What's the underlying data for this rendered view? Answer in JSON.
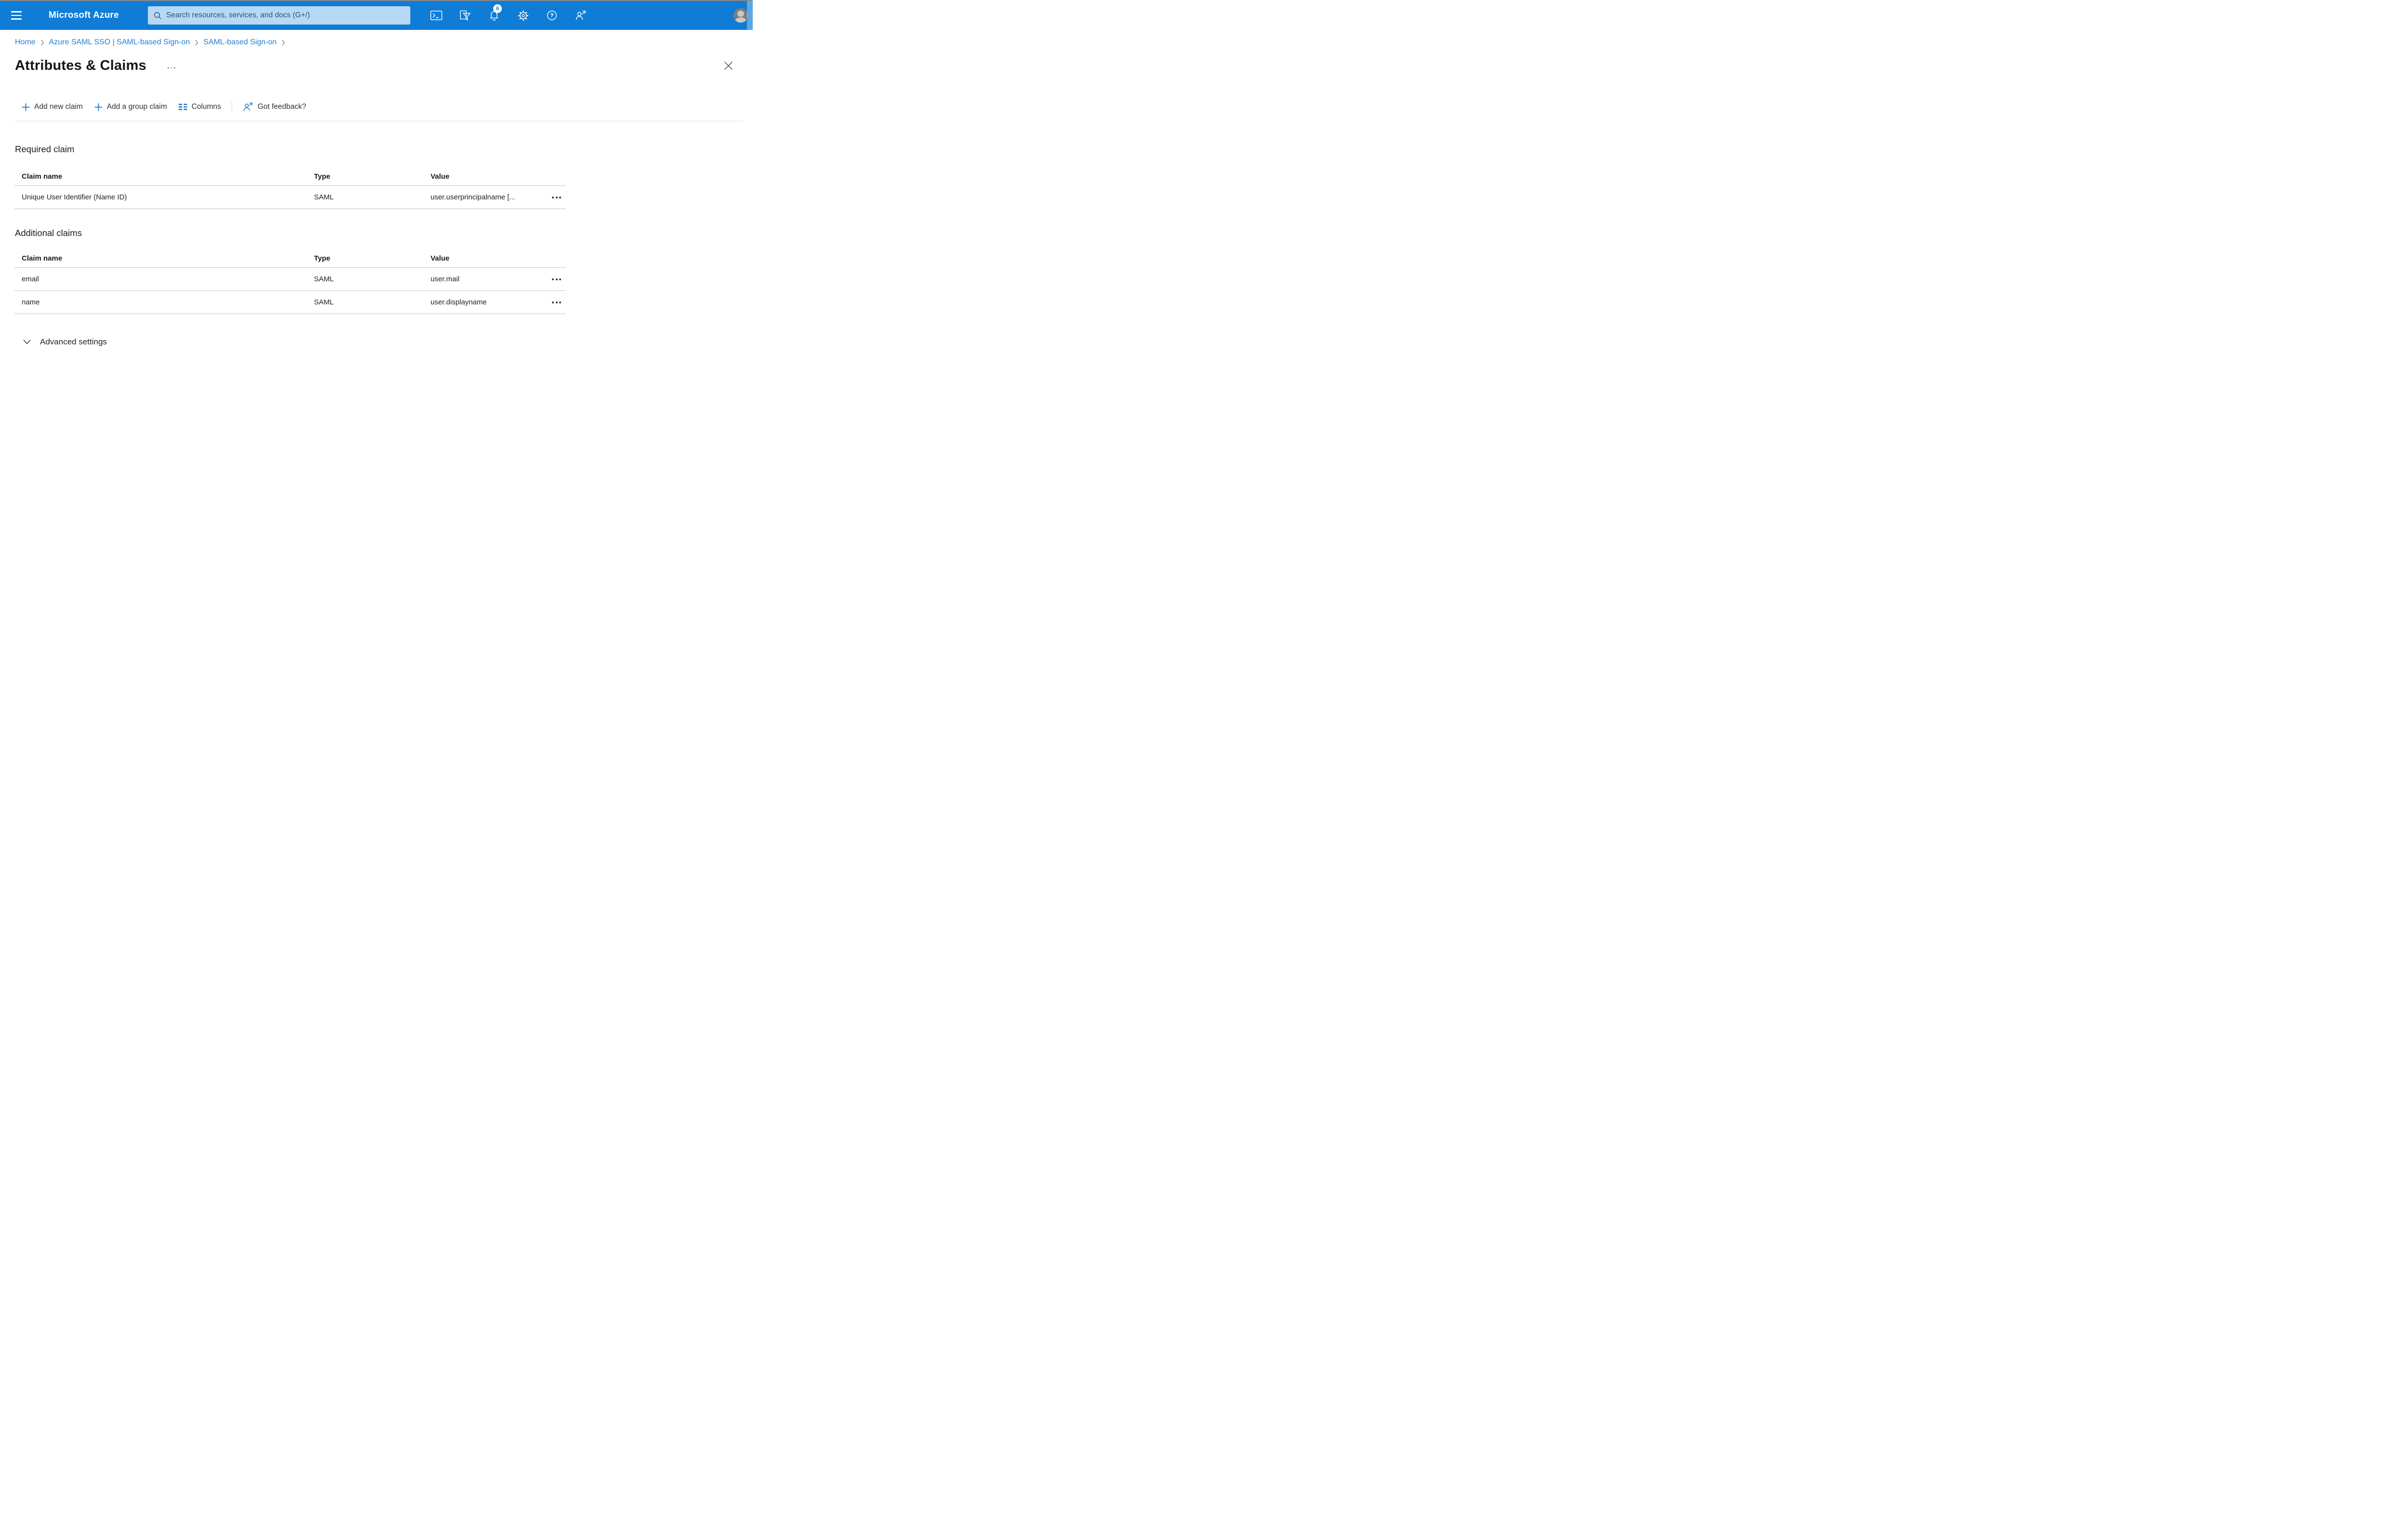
{
  "header": {
    "brand": "Microsoft Azure",
    "search_placeholder": "Search resources, services, and docs (G+/)",
    "notification_count": "6"
  },
  "breadcrumb": {
    "items": [
      {
        "label": "Home"
      },
      {
        "label": "Azure SAML SSO | SAML-based Sign-on"
      },
      {
        "label": "SAML-based Sign-on"
      }
    ]
  },
  "page": {
    "title": "Attributes & Claims"
  },
  "toolbar": {
    "add_new_claim": "Add new claim",
    "add_group_claim": "Add a group claim",
    "columns": "Columns",
    "got_feedback": "Got feedback?"
  },
  "required_claim": {
    "heading": "Required claim",
    "columns": [
      "Claim name",
      "Type",
      "Value"
    ],
    "rows": [
      {
        "claim_name": "Unique User Identifier (Name ID)",
        "type": "SAML",
        "value": "user.userprincipalname [..."
      }
    ]
  },
  "additional_claims": {
    "heading": "Additional claims",
    "columns": [
      "Claim name",
      "Type",
      "Value"
    ],
    "rows": [
      {
        "claim_name": "email",
        "type": "SAML",
        "value": "user.mail"
      },
      {
        "claim_name": "name",
        "type": "SAML",
        "value": "user.displayname"
      }
    ]
  },
  "advanced": {
    "label": "Advanced settings"
  },
  "colors": {
    "header_bg": "#0f7cd6",
    "accent_blue": "#1077d2",
    "link_blue": "#1e7fd8",
    "search_bg": "#b7d9f4",
    "search_text": "#2a5172",
    "badge_bg": "#ffffff",
    "badge_text": "#0f7cd6",
    "divider": "#c6c4c2",
    "text_dark": "#1b1a19",
    "text_gray": "#605e5c"
  }
}
